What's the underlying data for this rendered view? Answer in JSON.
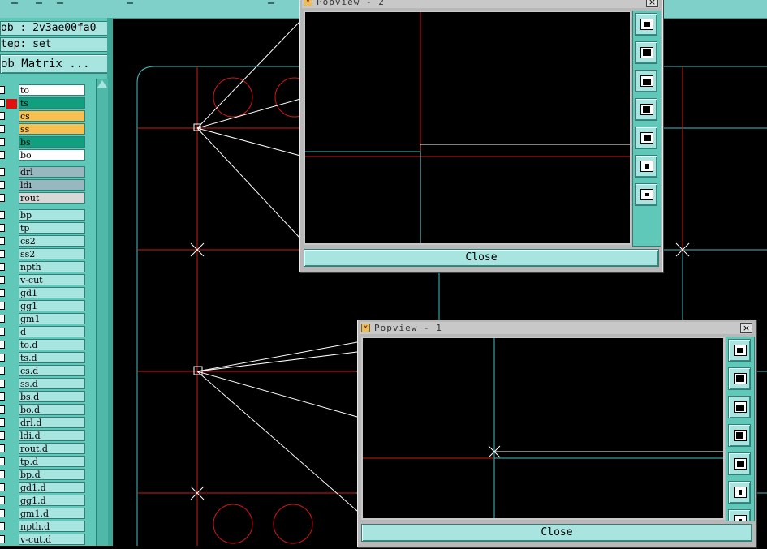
{
  "colors": {
    "canvas_bg": "#000000",
    "outline": "#3fbfbf",
    "red": "#d01818",
    "white": "#ffffff",
    "panel": "#5fc8b8",
    "button": "#a8e4e0"
  },
  "info": {
    "job": "ob : 2v3ae00fa0",
    "step": "tep: set",
    "matrix_button": "ob Matrix ..."
  },
  "layers": [
    {
      "name": "to",
      "color": "#ffffff",
      "mark": "",
      "group": 1
    },
    {
      "name": "ts",
      "color": "#10a080",
      "mark": "#e01010",
      "group": 1
    },
    {
      "name": "cs",
      "color": "#f8c050",
      "mark": "",
      "group": 1
    },
    {
      "name": "ss",
      "color": "#f8c050",
      "mark": "",
      "group": 1
    },
    {
      "name": "bs",
      "color": "#10a080",
      "mark": "",
      "group": 1
    },
    {
      "name": "bo",
      "color": "#ffffff",
      "mark": "",
      "group": 1
    },
    {
      "name": "drl",
      "color": "#98b8c0",
      "mark": "",
      "group": 2
    },
    {
      "name": "ldi",
      "color": "#98b8c0",
      "mark": "",
      "group": 2
    },
    {
      "name": "rout",
      "color": "#d8d8d8",
      "mark": "",
      "group": 2
    },
    {
      "name": "bp",
      "color": "#a8e4e0",
      "mark": "",
      "group": 3
    },
    {
      "name": "tp",
      "color": "#a8e4e0",
      "mark": "",
      "group": 3
    },
    {
      "name": "cs2",
      "color": "#a8e4e0",
      "mark": "",
      "group": 3
    },
    {
      "name": "ss2",
      "color": "#a8e4e0",
      "mark": "",
      "group": 3
    },
    {
      "name": "npth",
      "color": "#a8e4e0",
      "mark": "",
      "group": 3
    },
    {
      "name": "v-cut",
      "color": "#a8e4e0",
      "mark": "",
      "group": 3
    },
    {
      "name": "gd1",
      "color": "#a8e4e0",
      "mark": "",
      "group": 3
    },
    {
      "name": "gg1",
      "color": "#a8e4e0",
      "mark": "",
      "group": 3
    },
    {
      "name": "gm1",
      "color": "#a8e4e0",
      "mark": "",
      "group": 3
    },
    {
      "name": "d",
      "color": "#a8e4e0",
      "mark": "",
      "group": 3
    },
    {
      "name": "to.d",
      "color": "#a8e4e0",
      "mark": "",
      "group": 3
    },
    {
      "name": "ts.d",
      "color": "#a8e4e0",
      "mark": "",
      "group": 3
    },
    {
      "name": "cs.d",
      "color": "#a8e4e0",
      "mark": "",
      "group": 3
    },
    {
      "name": "ss.d",
      "color": "#a8e4e0",
      "mark": "",
      "group": 3
    },
    {
      "name": "bs.d",
      "color": "#a8e4e0",
      "mark": "",
      "group": 3
    },
    {
      "name": "bo.d",
      "color": "#a8e4e0",
      "mark": "",
      "group": 3
    },
    {
      "name": "drl.d",
      "color": "#a8e4e0",
      "mark": "",
      "group": 3
    },
    {
      "name": "ldi.d",
      "color": "#a8e4e0",
      "mark": "",
      "group": 3
    },
    {
      "name": "rout.d",
      "color": "#a8e4e0",
      "mark": "",
      "group": 3
    },
    {
      "name": "tp.d",
      "color": "#a8e4e0",
      "mark": "",
      "group": 3
    },
    {
      "name": "bp.d",
      "color": "#a8e4e0",
      "mark": "",
      "group": 3
    },
    {
      "name": "gd1.d",
      "color": "#a8e4e0",
      "mark": "",
      "group": 3
    },
    {
      "name": "gg1.d",
      "color": "#a8e4e0",
      "mark": "",
      "group": 3
    },
    {
      "name": "gm1.d",
      "color": "#a8e4e0",
      "mark": "",
      "group": 3
    },
    {
      "name": "npth.d",
      "color": "#a8e4e0",
      "mark": "",
      "group": 3
    },
    {
      "name": "v-cut.d",
      "color": "#a8e4e0",
      "mark": "",
      "group": 3
    }
  ],
  "popview2": {
    "title": "Popview - 2",
    "close_label": "Close",
    "x_icon": "×"
  },
  "popview1": {
    "title": "Popview - 1",
    "close_label": "Close",
    "x_icon": "×"
  },
  "toolbar_icons": [
    "zoom-home-icon",
    "pan-up-icon",
    "pan-down-icon",
    "pan-left-icon",
    "pan-right-icon",
    "zoom-in-icon",
    "zoom-out-icon"
  ]
}
